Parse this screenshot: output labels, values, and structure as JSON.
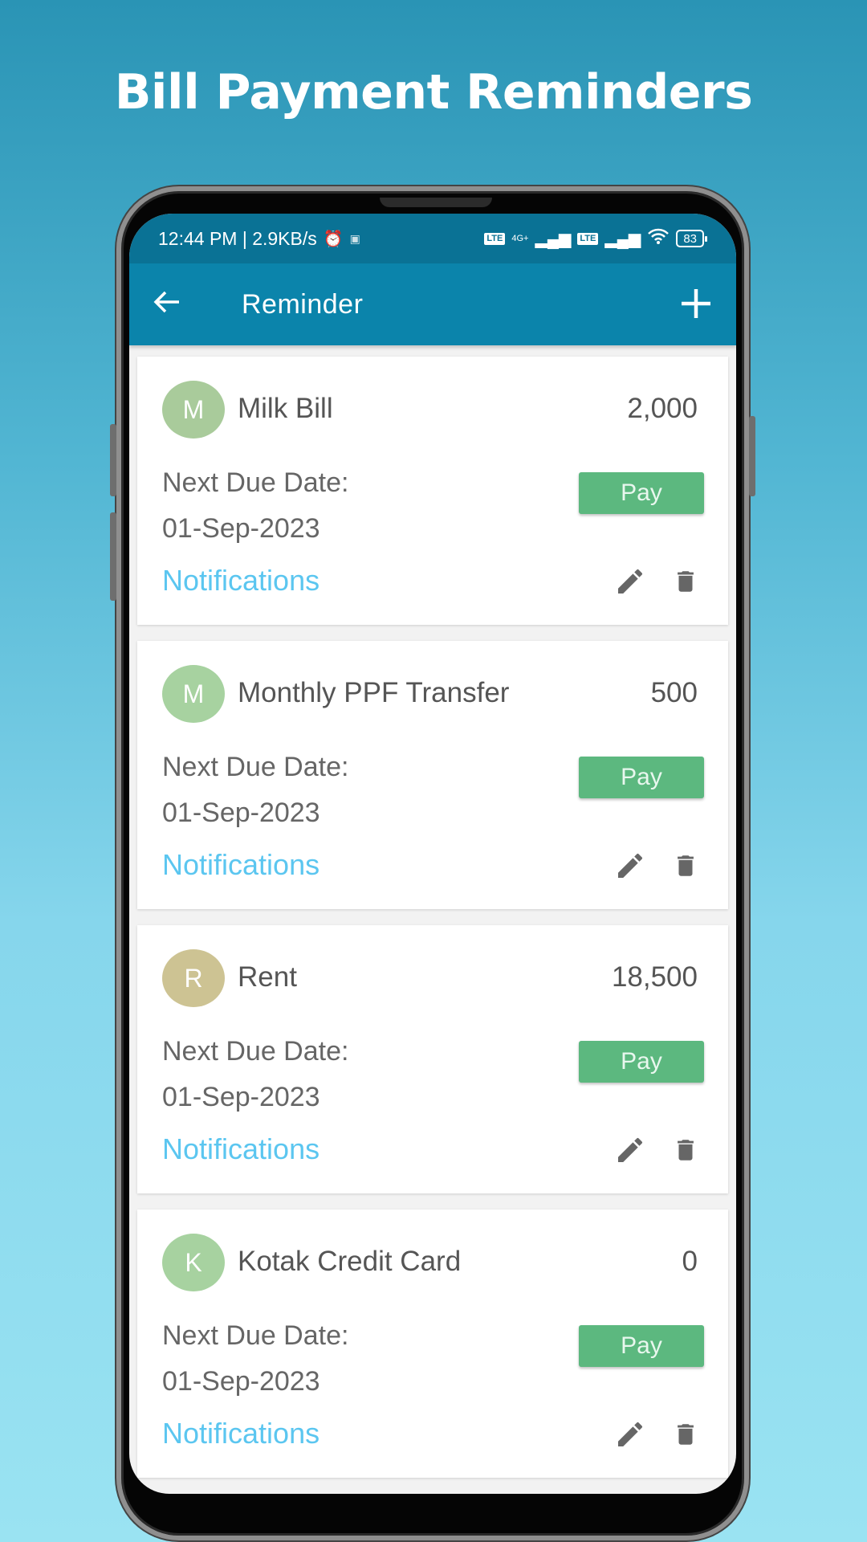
{
  "promo": {
    "title": "Bill Payment Reminders"
  },
  "status_bar": {
    "time_speed": "12:44 PM | 2.9KB/s",
    "alarm_icon": "alarm-icon",
    "network_label": "4G+",
    "volte_label": "Vo LTE",
    "battery": "83"
  },
  "app_bar": {
    "title": "Reminder",
    "back_icon": "←",
    "add_icon": "+"
  },
  "colors": {
    "app_bar": "#0b84ab",
    "status_bar": "#0a7295",
    "pay_button": "#5cb87f",
    "notifications_link": "#5bc6f0"
  },
  "reminders": [
    {
      "initial": "M",
      "avatar_color": "#a9cb9b",
      "name": "Milk Bill",
      "amount": "2,000",
      "due_label": "Next Due Date:",
      "due_date": "01-Sep-2023",
      "pay_label": "Pay",
      "notifications_label": "Notifications"
    },
    {
      "initial": "M",
      "avatar_color": "#a7d2a0",
      "name": "Monthly PPF Transfer",
      "amount": "500",
      "due_label": "Next Due Date:",
      "due_date": "01-Sep-2023",
      "pay_label": "Pay",
      "notifications_label": "Notifications"
    },
    {
      "initial": "R",
      "avatar_color": "#cdc393",
      "name": "Rent",
      "amount": "18,500",
      "due_label": "Next Due Date:",
      "due_date": "01-Sep-2023",
      "pay_label": "Pay",
      "notifications_label": "Notifications"
    },
    {
      "initial": "K",
      "avatar_color": "#a7d2a0",
      "name": "Kotak Credit Card",
      "amount": "0",
      "due_label": "Next Due Date:",
      "due_date": "01-Sep-2023",
      "pay_label": "Pay",
      "notifications_label": "Notifications"
    }
  ]
}
